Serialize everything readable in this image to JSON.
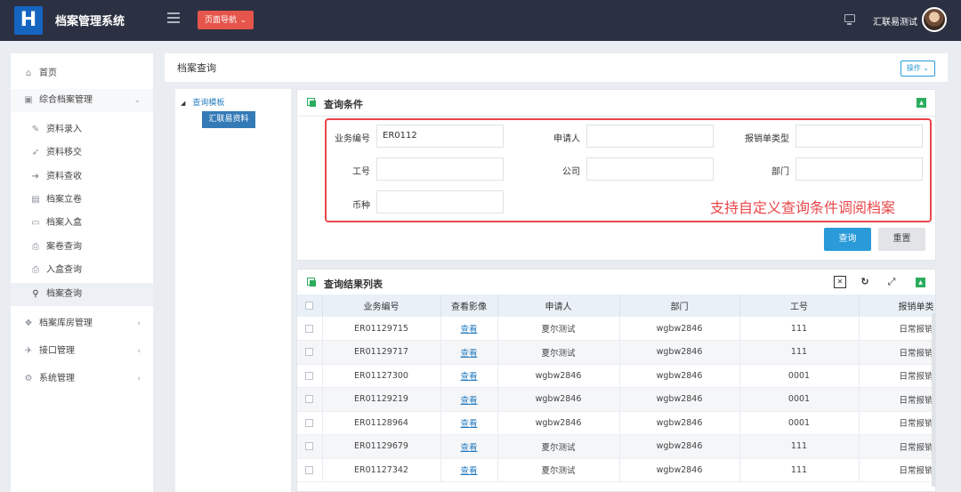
{
  "header": {
    "logo_text": "H",
    "app_title": "档案管理系统",
    "nav_button": "页面导航",
    "user_name": "汇联易测试"
  },
  "sidebar": {
    "items": [
      {
        "label": "首页",
        "icon": "home-icon"
      },
      {
        "label": "综合档案管理",
        "icon": "file-icon",
        "expanded": true
      },
      {
        "label": "资料录入",
        "icon": "edit-icon"
      },
      {
        "label": "资料移交",
        "icon": "send-icon"
      },
      {
        "label": "资料查收",
        "icon": "sign-in-icon"
      },
      {
        "label": "档案立卷",
        "icon": "archive-icon"
      },
      {
        "label": "档案入盒",
        "icon": "box-icon"
      },
      {
        "label": "案卷查询",
        "icon": "print-icon"
      },
      {
        "label": "入盒查询",
        "icon": "print-icon"
      },
      {
        "label": "档案查询",
        "icon": "search-icon",
        "active": true
      },
      {
        "label": "档案库房管理",
        "icon": "users-icon"
      },
      {
        "label": "接口管理",
        "icon": "plug-icon"
      },
      {
        "label": "系统管理",
        "icon": "cogs-icon"
      }
    ]
  },
  "breadcrumb": {
    "title": "档案查询",
    "op_button": "操作"
  },
  "tree": {
    "node": "查询模板",
    "leaf": "汇联易资料"
  },
  "query_panel": {
    "title": "查询条件",
    "fields": {
      "business_no": {
        "label": "业务编号",
        "value": "ER0112"
      },
      "applicant": {
        "label": "申请人",
        "value": ""
      },
      "report_type": {
        "label": "报销单类型",
        "value": ""
      },
      "employee_no": {
        "label": "工号",
        "value": ""
      },
      "company": {
        "label": "公司",
        "value": ""
      },
      "department": {
        "label": "部门",
        "value": ""
      },
      "currency": {
        "label": "币种",
        "value": ""
      }
    },
    "annotation": "支持自定义查询条件调阅档案",
    "search_button": "查询",
    "reset_button": "重置"
  },
  "result_panel": {
    "title": "查询结果列表",
    "columns": [
      "业务编号",
      "查看影像",
      "申请人",
      "部门",
      "工号",
      "报销单类"
    ],
    "rows": [
      [
        "ER01129715",
        "查看",
        "夏尔测试",
        "wgbw2846",
        "111",
        "日常报销"
      ],
      [
        "ER01129717",
        "查看",
        "夏尔测试",
        "wgbw2846",
        "111",
        "日常报销"
      ],
      [
        "ER01127300",
        "查看",
        "wgbw2846",
        "wgbw2846",
        "0001",
        "日常报销"
      ],
      [
        "ER01129219",
        "查看",
        "wgbw2846",
        "wgbw2846",
        "0001",
        "日常报销"
      ],
      [
        "ER01128964",
        "查看",
        "wgbw2846",
        "wgbw2846",
        "0001",
        "日常报销"
      ],
      [
        "ER01129679",
        "查看",
        "夏尔测试",
        "wgbw2846",
        "111",
        "日常报销"
      ],
      [
        "ER01127342",
        "查看",
        "夏尔测试",
        "wgbw2846",
        "111",
        "日常报销"
      ]
    ]
  },
  "colors": {
    "topbar": "#2b3142",
    "accent": "#2a9bd8",
    "nav_button": "#e5554b",
    "annotation": "#e8474a",
    "panel_icon": "#2cac5d"
  }
}
